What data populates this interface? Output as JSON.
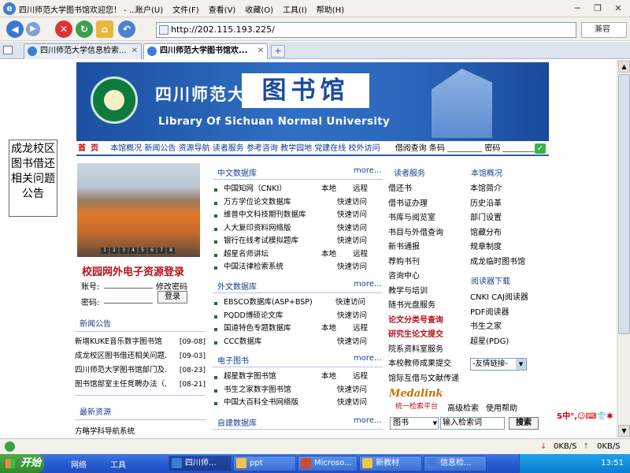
{
  "browser": {
    "window_title": "四川师范大学图书馆欢迎您！ - ...",
    "menu": [
      "账户(U)",
      "文件(F)",
      "查看(V)",
      "收藏(O)",
      "工具(I)",
      "帮助(H)"
    ],
    "address": "http://202.115.193.225/",
    "compat_label": "兼容",
    "tabs": [
      {
        "title": "四川师范大学信息检索...",
        "active": false
      },
      {
        "title": "四川师范大学图书馆欢...",
        "active": true
      }
    ]
  },
  "floating_notice": "成龙校区图书借还相关问题公告",
  "banner": {
    "school": "四川师范大学",
    "library": "图书馆",
    "english": "Library Of Sichuan Normal University"
  },
  "nav": {
    "home": "首页",
    "items": [
      "本馆概况",
      "新闻公告",
      "资源导航",
      "读者服务",
      "参考咨询",
      "教学园地",
      "党建在线",
      "校外访问"
    ],
    "borrow_query": "借阅查询",
    "barcode_label": "条码",
    "password_label": "密码"
  },
  "login": {
    "title": "校园网外电子资源登录",
    "account_label": "账号:",
    "change_password": "修改密码",
    "password_label": "密码:",
    "submit": "登录"
  },
  "photo_slides": [
    "1",
    "2",
    "3",
    "4",
    "5",
    "6",
    "7",
    "8"
  ],
  "news": {
    "title": "新闻公告",
    "items": [
      {
        "text": "新增KUKE音乐数字图书馆",
        "date": "[09-08]"
      },
      {
        "text": "成龙校区图书借还相关问题.",
        "date": "[09-03]"
      },
      {
        "text": "四川师范大学图书馆部门及.",
        "date": "[08-23]"
      },
      {
        "text": "图书馆部室主任竞聘办法（.",
        "date": "[08-21]"
      }
    ]
  },
  "latest_resources": {
    "title": "最新资源",
    "items": [
      "方略学科导航系统"
    ]
  },
  "chinese_db": {
    "title": "中文数据库",
    "more": "more...",
    "rows": [
      {
        "name": "中国知网（CNKI）",
        "c1": "本地",
        "c2": "远程"
      },
      {
        "name": "万方学位论文数据库",
        "c1": "",
        "c2": "快速访问"
      },
      {
        "name": "维普中文科技期刊数据库",
        "c1": "",
        "c2": "快速访问"
      },
      {
        "name": "人大复印资料网络版",
        "c1": "",
        "c2": "快速访问"
      },
      {
        "name": "银行在线考试模拟题库",
        "c1": "",
        "c2": "快速访问"
      },
      {
        "name": "超星名师讲坛",
        "c1": "本地",
        "c2": "远程"
      },
      {
        "name": "中国法律检索系统",
        "c1": "",
        "c2": "快速访问"
      }
    ]
  },
  "foreign_db": {
    "title": "外文数据库",
    "more": "more...",
    "rows": [
      {
        "name": "EBSCO数据库(ASP+BSP)",
        "c1": "",
        "c2": "快速访问"
      },
      {
        "name": "PQDD博硕论文库",
        "c1": "",
        "c2": "快速访问"
      },
      {
        "name": "国道特色专题数据库",
        "c1": "本地",
        "c2": "远程"
      },
      {
        "name": "CCC数据库",
        "c1": "",
        "c2": "快速访问"
      }
    ]
  },
  "ebooks": {
    "title": "电子图书",
    "more": "more...",
    "rows": [
      {
        "name": "超星数字图书馆",
        "c1": "本地",
        "c2": "远程"
      },
      {
        "name": "书生之家数字图书馆",
        "c1": "",
        "c2": "快速访问"
      },
      {
        "name": "中国大百科全书网络版",
        "c1": "",
        "c2": "快速访问"
      }
    ]
  },
  "self_db": {
    "title": "自建数据库",
    "more": "more..."
  },
  "reader_services": {
    "title": "读者服务",
    "items": [
      {
        "label": "借还书",
        "highlight": false
      },
      {
        "label": "借书证办理",
        "highlight": false
      },
      {
        "label": "书库与阅览室",
        "highlight": false
      },
      {
        "label": "书目与外借查询",
        "highlight": false
      },
      {
        "label": "新书通报",
        "highlight": false
      },
      {
        "label": "荐购书刊",
        "highlight": false
      },
      {
        "label": "咨询中心",
        "highlight": false
      },
      {
        "label": "教学与培训",
        "highlight": false
      },
      {
        "label": "随书光盘服务",
        "highlight": false
      },
      {
        "label": "论文分类号查询",
        "highlight": true
      },
      {
        "label": "研究生论文提交",
        "highlight": true
      },
      {
        "label": "院系资料室服务",
        "highlight": false
      },
      {
        "label": "本校教师成果提交",
        "highlight": false
      },
      {
        "label": "馆际互借与文献传递",
        "highlight": false
      }
    ]
  },
  "about": {
    "title": "本馆概况",
    "items": [
      "本馆简介",
      "历史沿革",
      "部门设置",
      "馆藏分布",
      "规章制度",
      "成龙临时图书馆"
    ]
  },
  "readers": {
    "title": "阅读器下载",
    "items": [
      "CNKI CAJ阅读器",
      "PDF阅读器",
      "书生之家",
      "超星(PDG)"
    ]
  },
  "friend_links": "-友情链接-",
  "medalink": {
    "brand": "Medalink",
    "subtitle": "统一检索平台",
    "advanced": "高级检索",
    "help": "使用帮助"
  },
  "search": {
    "type": "图书",
    "placeholder": "输入检索词",
    "button": "搜索"
  },
  "status": {
    "speed_up": "0KB/S",
    "speed_down": "0KB/S"
  },
  "taskbar": {
    "start": "开始",
    "quick": [
      "网络",
      "工具"
    ],
    "buttons": [
      {
        "label": "四川师...",
        "active": true
      },
      {
        "label": "ppt",
        "active": false
      },
      {
        "label": "Microso...",
        "active": false
      },
      {
        "label": "新教材",
        "active": false
      },
      {
        "label": "信息检...",
        "active": false
      }
    ],
    "clock": "13:51"
  },
  "colors": {
    "brand_blue": "#1b4b9b",
    "accent_red": "#b5121b",
    "nav_underline": "#2b5fad"
  }
}
